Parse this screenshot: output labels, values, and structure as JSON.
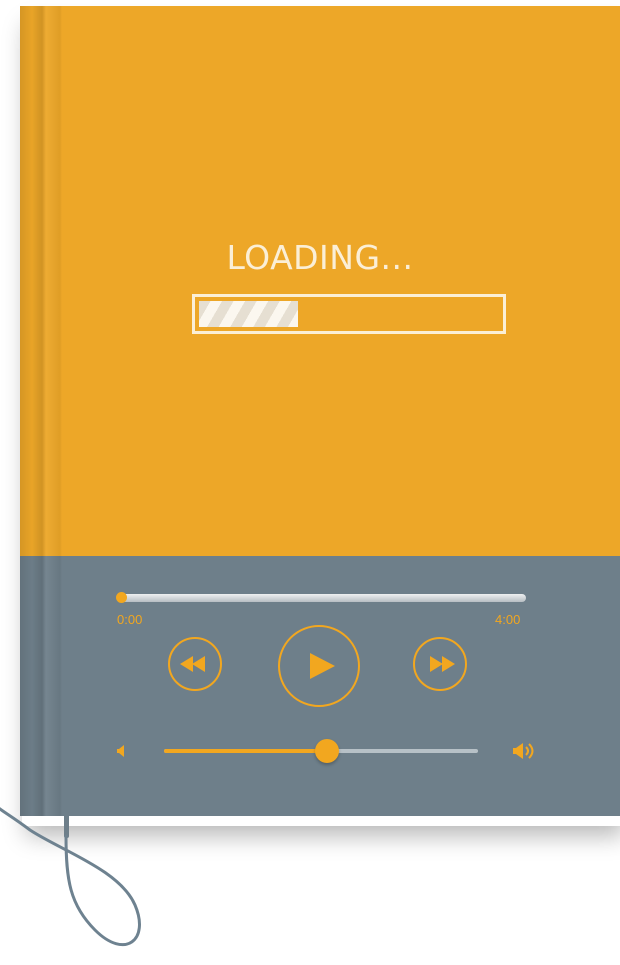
{
  "loading": {
    "label": "LOADING...",
    "progress": 0.33
  },
  "player": {
    "seek": {
      "current_time": "0:00",
      "total_time": "4:00",
      "position": 0.0
    },
    "controls": {
      "rewind_icon": "rewind-icon",
      "play_icon": "play-icon",
      "forward_icon": "fast-forward-icon"
    },
    "volume": {
      "level": 0.52,
      "low_icon": "volume-low-icon",
      "high_icon": "volume-high-icon"
    }
  },
  "colors": {
    "cover_top": "#eda728",
    "cover_bottom": "#6e7f8a",
    "accent": "#f2a71f",
    "light_text": "#fbefd6"
  }
}
